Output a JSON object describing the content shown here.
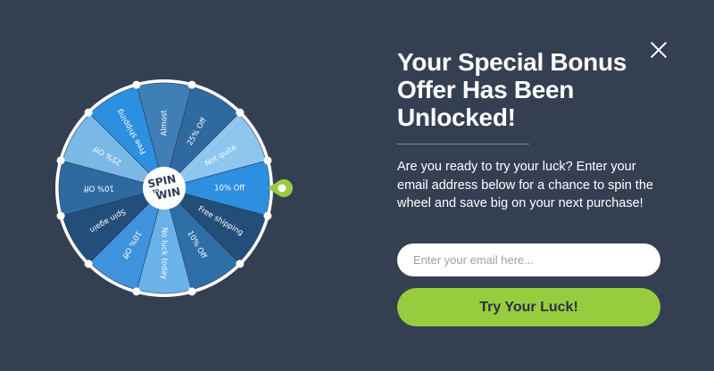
{
  "wheel": {
    "logo_line1": "SPIN",
    "logo_line2": "WIN",
    "logo_to": "TO",
    "segments": [
      {
        "label": "Almost",
        "color": "#3f7fb5"
      },
      {
        "label": "25% Off",
        "color": "#2e6aa0"
      },
      {
        "label": "Not quite",
        "color": "#8ec6f0"
      },
      {
        "label": "10% Off",
        "color": "#2d8fe0"
      },
      {
        "label": "Free shipping",
        "color": "#234e7a"
      },
      {
        "label": "10% Off",
        "color": "#2f6fa8"
      },
      {
        "label": "No luck today",
        "color": "#6bb1ea"
      },
      {
        "label": "10% Off",
        "color": "#3f92dc"
      },
      {
        "label": "Spin again",
        "color": "#234e7a"
      },
      {
        "label": "10% Off",
        "color": "#2e6aa0"
      },
      {
        "label": "25% Off",
        "color": "#7ab8e6"
      },
      {
        "label": "Free shipping",
        "color": "#2d8fe0"
      }
    ],
    "pointer_color": "#98cc3f"
  },
  "offer": {
    "title": "Your Special Bonus Offer Has Been Unlocked!",
    "description": "Are you ready to try your luck? Enter your email address below for a chance to spin the wheel and save big on your next purchase!",
    "email_placeholder": "Enter your email here...",
    "email_value": "",
    "cta_label": "Try Your Luck!"
  },
  "close_icon": "close-icon"
}
